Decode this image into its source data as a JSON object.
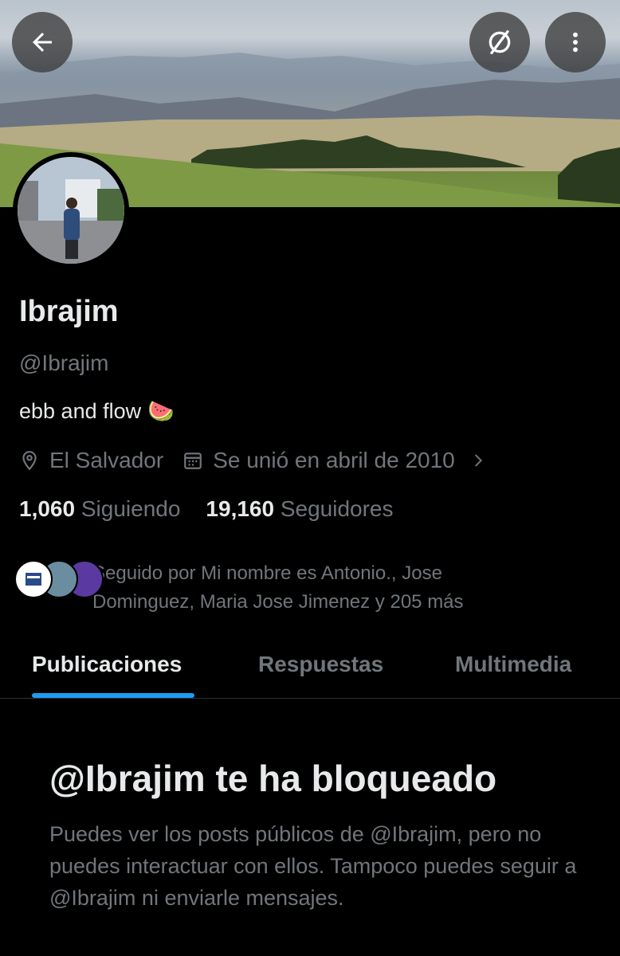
{
  "header": {
    "back_icon": "arrow-left-icon",
    "hide_icon": "slashed-circle-icon",
    "more_icon": "vertical-dots-icon"
  },
  "profile": {
    "name": "Ibrajim",
    "handle": "@Ibrajim",
    "bio_text": "ebb and flow",
    "bio_emoji": "🍉",
    "location": "El Salvador",
    "joined": "Se unió en abril de 2010",
    "following_count": "1,060",
    "following_label": "Siguiendo",
    "followers_count": "19,160",
    "followers_label": "Seguidores",
    "followed_by": "Seguido por Mi nombre es Antonio., Jose Dominguez, Maria Jose Jimenez y 205 más"
  },
  "tabs": [
    {
      "label": "Publicaciones",
      "active": true
    },
    {
      "label": "Respuestas",
      "active": false
    },
    {
      "label": "Multimedia",
      "active": false
    }
  ],
  "blocked": {
    "title": "@Ibrajim te ha bloqueado",
    "text": "Puedes ver los posts públicos de @Ibrajim, pero no puedes interactuar con ellos. Tampoco puedes seguir a @Ibrajim ni enviarle mensajes."
  },
  "colors": {
    "background": "#000000",
    "primary_text": "#e7e9ea",
    "secondary_text": "#71767b",
    "accent": "#1d9bf0"
  }
}
